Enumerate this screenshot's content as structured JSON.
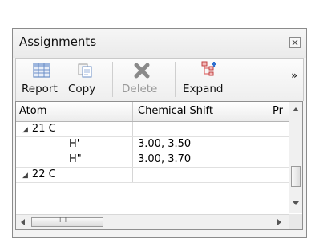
{
  "panel": {
    "title": "Assignments"
  },
  "toolbar": {
    "buttons": [
      {
        "label": "Report",
        "icon": "table-icon",
        "enabled": true
      },
      {
        "label": "Copy",
        "icon": "copy-icon",
        "enabled": true
      },
      {
        "label": "Delete",
        "icon": "delete-x-icon",
        "enabled": false
      },
      {
        "label": "Expand",
        "icon": "expand-tree-icon",
        "enabled": true
      }
    ],
    "overflow": "»"
  },
  "grid": {
    "columns": [
      "Atom",
      "Chemical Shift",
      "Pr"
    ],
    "rows": [
      {
        "type": "group",
        "caret": "◢",
        "atom": "21 C",
        "shift": ""
      },
      {
        "type": "child",
        "caret": "",
        "atom": "H'",
        "shift": "3.00, 3.50"
      },
      {
        "type": "child",
        "caret": "",
        "atom": "H\"",
        "shift": "3.00, 3.70"
      },
      {
        "type": "group",
        "caret": "◢",
        "atom": "22 C",
        "shift": ""
      }
    ],
    "hscroll_grip": "III"
  },
  "colors": {
    "border": "#8b8b8b",
    "header": "#ececec",
    "accent": "#6b8fc7"
  }
}
